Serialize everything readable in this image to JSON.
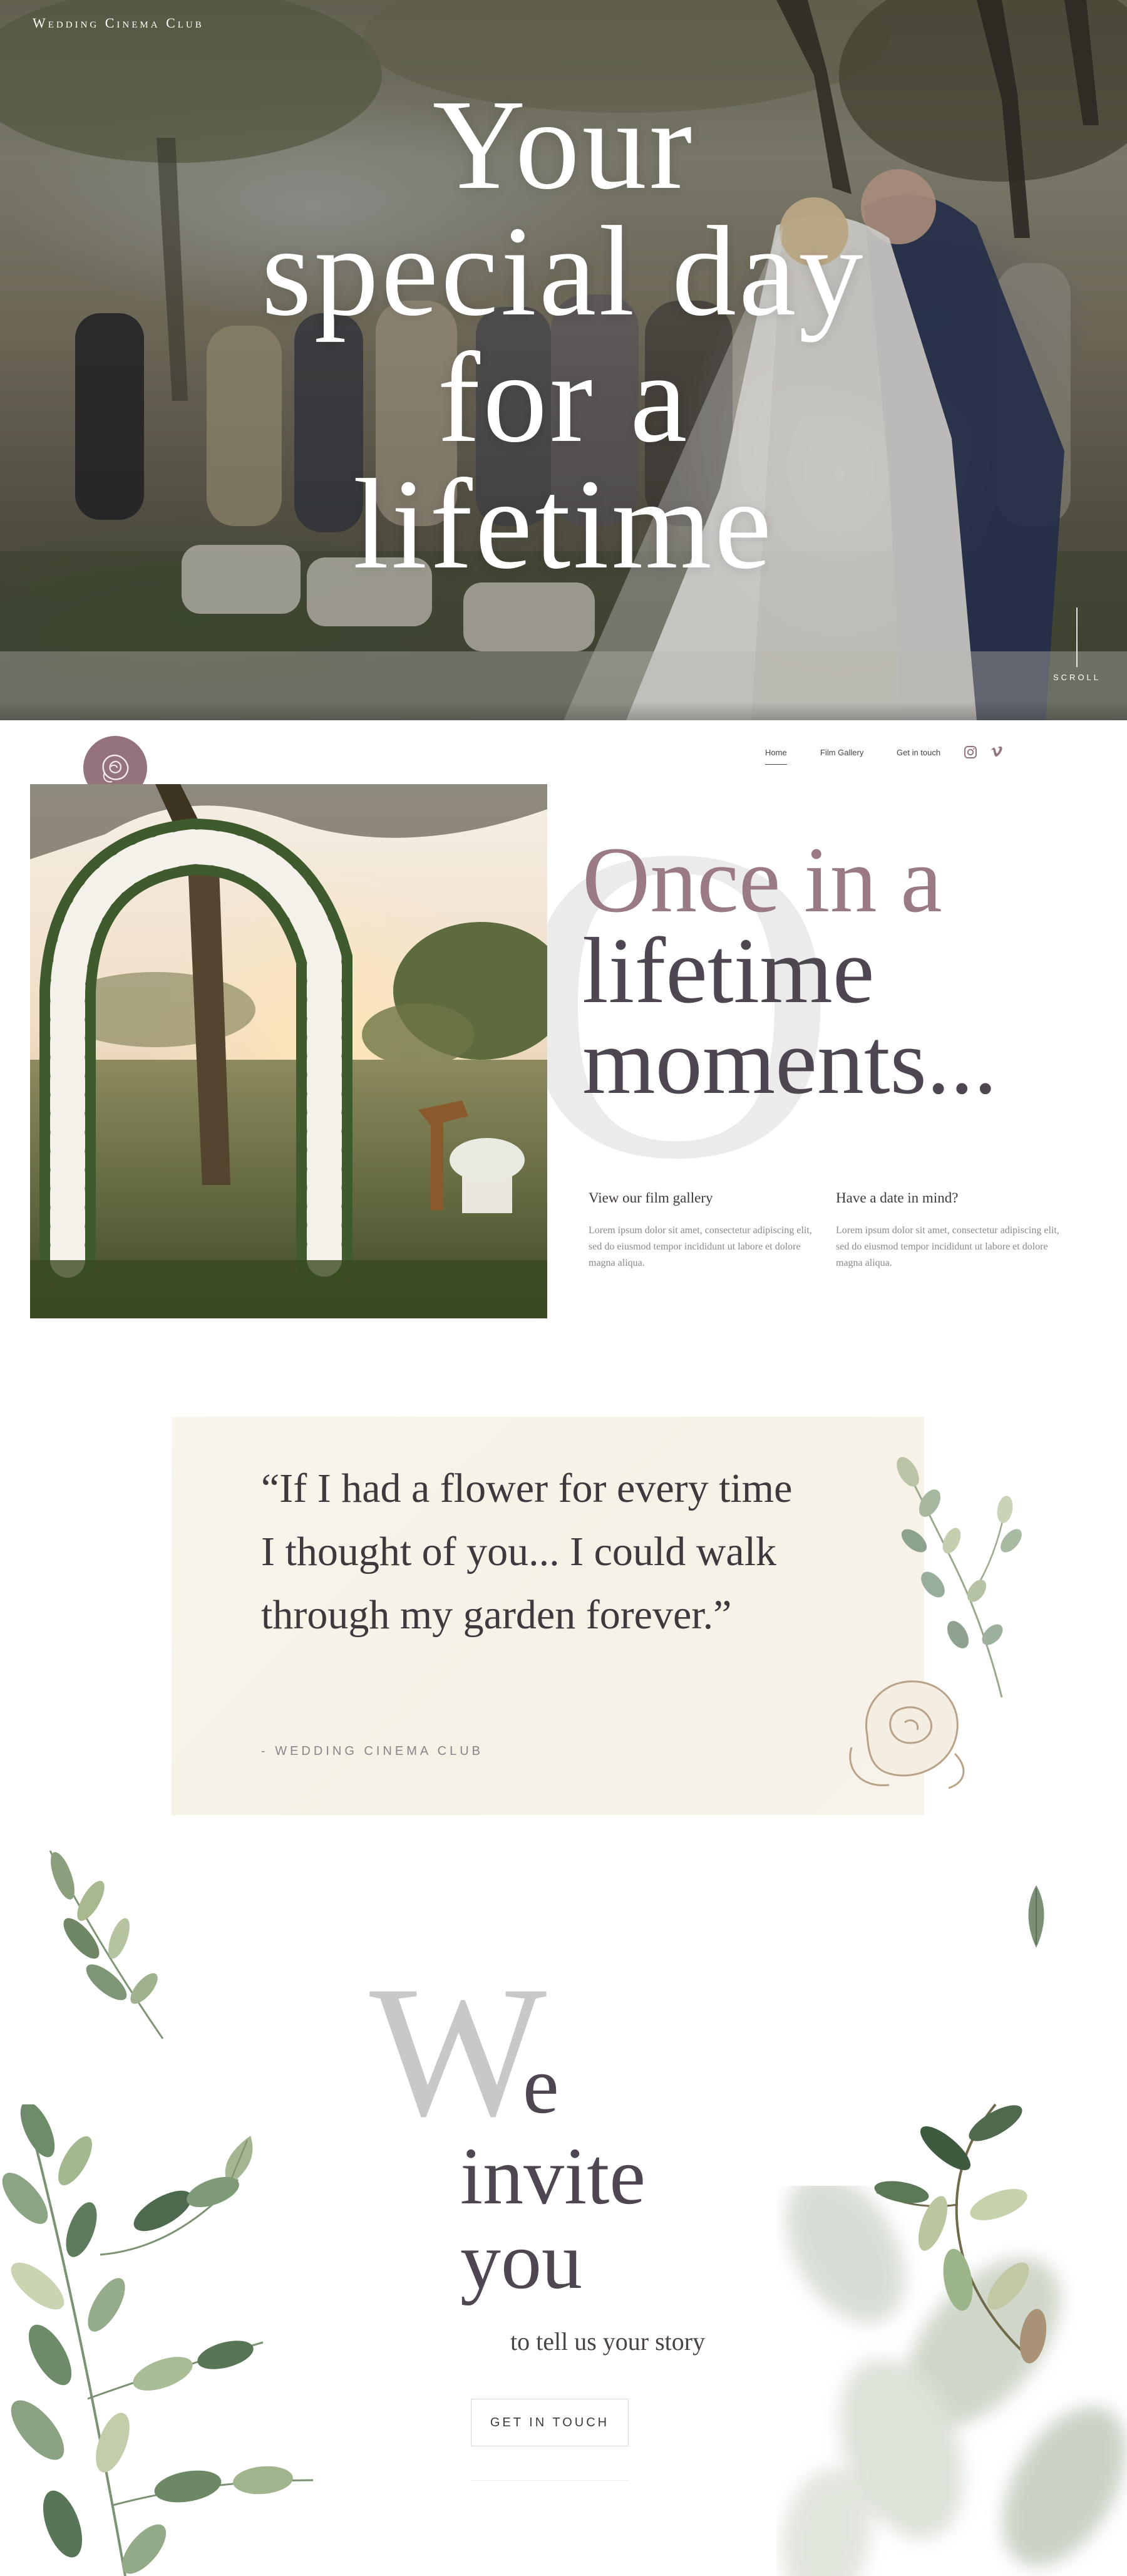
{
  "brand": {
    "logo_text": "Wedding Cinema Club"
  },
  "hero": {
    "title_lines": [
      "Your",
      "special day",
      "for a",
      "lifetime"
    ],
    "scroll_label": "SCROLL"
  },
  "nav": {
    "items": [
      {
        "label": "Home",
        "active": true
      },
      {
        "label": "Film Gallery",
        "active": false
      },
      {
        "label": "Get in touch",
        "active": false
      }
    ],
    "social": [
      "instagram-icon",
      "vimeo-icon"
    ]
  },
  "intro": {
    "decor_letter": "O",
    "heading": [
      "Once in a",
      "lifetime",
      "moments..."
    ],
    "columns": [
      {
        "title": "View our film gallery",
        "body": "Lorem ipsum dolor sit amet, consectetur adipiscing elit, sed do eiusmod tempor incididunt ut labore et dolore magna aliqua."
      },
      {
        "title": "Have a date in mind?",
        "body": "Lorem ipsum dolor sit amet, consectetur adipiscing elit, sed do eiusmod tempor incididunt ut labore et dolore magna aliqua."
      }
    ]
  },
  "quote": {
    "text": "“If I had a flower for every time I thought of you... I could walk through my garden forever.”",
    "attribution": "- WEDDING CINEMA CLUB"
  },
  "invite": {
    "big_letter": "W",
    "heading_e": "e",
    "heading_line2": "invite",
    "heading_line3": "you",
    "subtitle": "to tell us your story",
    "button_label": "GET IN TOUCH"
  },
  "colors": {
    "accent_mauve": "#94737d",
    "heading_dark": "#4e4650",
    "quote_bg": "#f6f2e8",
    "leaf_green": "#7f9a7a"
  }
}
